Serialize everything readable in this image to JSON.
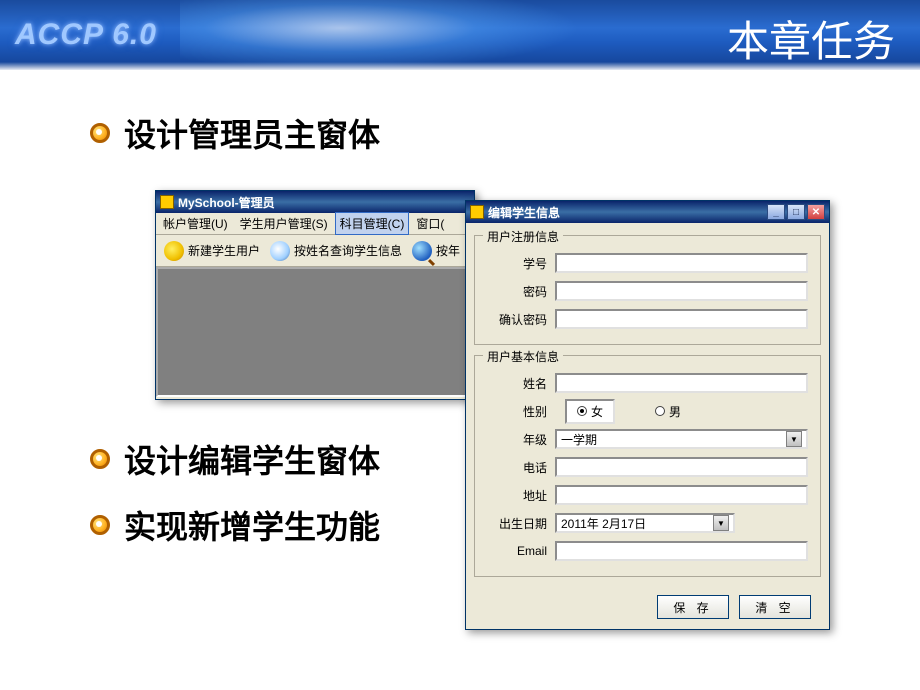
{
  "header": {
    "brand": "ACCP 6.0",
    "title": "本章任务"
  },
  "bullets": {
    "b1": "设计管理员主窗体",
    "b2": "设计编辑学生窗体",
    "b3": "实现新增学生功能"
  },
  "adminWindow": {
    "title": "MySchool-管理员",
    "menus": {
      "account": "帐户管理(U)",
      "student": "学生用户管理(S)",
      "subject": "科目管理(C)",
      "window": "窗口(",
      "partial": ""
    },
    "toolbar": {
      "newStudent": "新建学生用户",
      "queryByName": "按姓名查询学生信息",
      "queryByGrade": "按年"
    }
  },
  "editWindow": {
    "title": "编辑学生信息",
    "groupReg": "用户注册信息",
    "groupBasic": "用户基本信息",
    "labels": {
      "studentId": "学号",
      "password": "密码",
      "confirm": "确认密码",
      "name": "姓名",
      "gender": "性别",
      "grade": "年级",
      "phone": "电话",
      "address": "地址",
      "birth": "出生日期",
      "email": "Email"
    },
    "gender": {
      "female": "女",
      "male": "男",
      "selected": "female"
    },
    "gradeValue": "一学期",
    "birthValue": "2011年 2月17日",
    "buttons": {
      "save": "保 存",
      "clear": "清 空"
    }
  },
  "winBtns": {
    "min": "_",
    "max": "□",
    "close": "✕"
  }
}
